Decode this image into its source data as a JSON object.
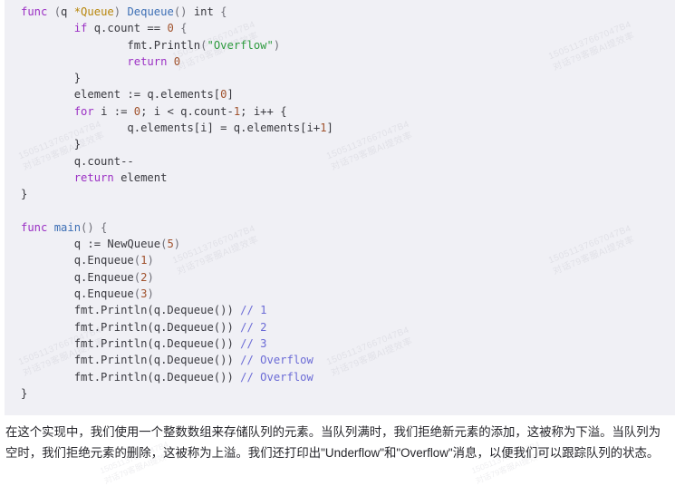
{
  "code_block": {
    "language": "go",
    "background_color": "#f0f0f5",
    "watermark_line1": "15051137667047B4",
    "watermark_line2": "对话79客服AI提效率",
    "lines": [
      {
        "indent": 0,
        "tokens": [
          {
            "t": "func ",
            "c": "kw"
          },
          {
            "t": "(",
            "c": "pun"
          },
          {
            "t": "q ",
            "c": "pl"
          },
          {
            "t": "*Queue",
            "c": "typ"
          },
          {
            "t": ") ",
            "c": "pun"
          },
          {
            "t": "Dequeue",
            "c": "fn"
          },
          {
            "t": "() ",
            "c": "pun"
          },
          {
            "t": "int",
            "c": "pl"
          },
          {
            "t": " {",
            "c": "pun"
          }
        ]
      },
      {
        "indent": 1,
        "tokens": [
          {
            "t": "if ",
            "c": "kw"
          },
          {
            "t": "q.count == ",
            "c": "pl"
          },
          {
            "t": "0",
            "c": "num"
          },
          {
            "t": " {",
            "c": "pun"
          }
        ]
      },
      {
        "indent": 2,
        "tokens": [
          {
            "t": "fmt.",
            "c": "pl"
          },
          {
            "t": "Println",
            "c": "pl"
          },
          {
            "t": "(",
            "c": "pun"
          },
          {
            "t": "\"Overflow\"",
            "c": "str"
          },
          {
            "t": ")",
            "c": "pun"
          }
        ]
      },
      {
        "indent": 2,
        "tokens": [
          {
            "t": "return ",
            "c": "kw"
          },
          {
            "t": "0",
            "c": "num"
          }
        ]
      },
      {
        "indent": 1,
        "tokens": [
          {
            "t": "}",
            "c": "pl"
          }
        ]
      },
      {
        "indent": 1,
        "tokens": [
          {
            "t": "element := q.elements[",
            "c": "pl"
          },
          {
            "t": "0",
            "c": "num"
          },
          {
            "t": "]",
            "c": "pl"
          }
        ]
      },
      {
        "indent": 1,
        "tokens": [
          {
            "t": "for ",
            "c": "kw"
          },
          {
            "t": "i := ",
            "c": "pl"
          },
          {
            "t": "0",
            "c": "num"
          },
          {
            "t": "; i < q.count-",
            "c": "pl"
          },
          {
            "t": "1",
            "c": "num"
          },
          {
            "t": "; i++ {",
            "c": "pl"
          }
        ]
      },
      {
        "indent": 2,
        "tokens": [
          {
            "t": "q.elements[i] = q.elements[i+",
            "c": "pl"
          },
          {
            "t": "1",
            "c": "num"
          },
          {
            "t": "]",
            "c": "pl"
          }
        ]
      },
      {
        "indent": 1,
        "tokens": [
          {
            "t": "}",
            "c": "pl"
          }
        ]
      },
      {
        "indent": 1,
        "tokens": [
          {
            "t": "q.count--",
            "c": "pl"
          }
        ]
      },
      {
        "indent": 1,
        "tokens": [
          {
            "t": "return ",
            "c": "kw"
          },
          {
            "t": "element",
            "c": "pl"
          }
        ]
      },
      {
        "indent": 0,
        "tokens": [
          {
            "t": "}",
            "c": "pl"
          }
        ]
      },
      {
        "indent": 0,
        "tokens": [
          {
            "t": "",
            "c": "pl"
          }
        ]
      },
      {
        "indent": 0,
        "tokens": [
          {
            "t": "func ",
            "c": "kw"
          },
          {
            "t": "main",
            "c": "fn"
          },
          {
            "t": "() {",
            "c": "pun"
          }
        ]
      },
      {
        "indent": 1,
        "tokens": [
          {
            "t": "q := ",
            "c": "pl"
          },
          {
            "t": "NewQueue",
            "c": "pl"
          },
          {
            "t": "(",
            "c": "pun"
          },
          {
            "t": "5",
            "c": "num"
          },
          {
            "t": ")",
            "c": "pun"
          }
        ]
      },
      {
        "indent": 1,
        "tokens": [
          {
            "t": "q.Enqueue",
            "c": "pl"
          },
          {
            "t": "(",
            "c": "pun"
          },
          {
            "t": "1",
            "c": "num"
          },
          {
            "t": ")",
            "c": "pun"
          }
        ]
      },
      {
        "indent": 1,
        "tokens": [
          {
            "t": "q.Enqueue",
            "c": "pl"
          },
          {
            "t": "(",
            "c": "pun"
          },
          {
            "t": "2",
            "c": "num"
          },
          {
            "t": ")",
            "c": "pun"
          }
        ]
      },
      {
        "indent": 1,
        "tokens": [
          {
            "t": "q.Enqueue",
            "c": "pl"
          },
          {
            "t": "(",
            "c": "pun"
          },
          {
            "t": "3",
            "c": "num"
          },
          {
            "t": ")",
            "c": "pun"
          }
        ]
      },
      {
        "indent": 1,
        "tokens": [
          {
            "t": "fmt.Println(q.Dequeue()) ",
            "c": "pl"
          },
          {
            "t": "// 1",
            "c": "cmt"
          }
        ]
      },
      {
        "indent": 1,
        "tokens": [
          {
            "t": "fmt.Println(q.Dequeue()) ",
            "c": "pl"
          },
          {
            "t": "// 2",
            "c": "cmt"
          }
        ]
      },
      {
        "indent": 1,
        "tokens": [
          {
            "t": "fmt.Println(q.Dequeue()) ",
            "c": "pl"
          },
          {
            "t": "// 3",
            "c": "cmt"
          }
        ]
      },
      {
        "indent": 1,
        "tokens": [
          {
            "t": "fmt.Println(q.Dequeue()) ",
            "c": "pl"
          },
          {
            "t": "// Overflow",
            "c": "cmt"
          }
        ]
      },
      {
        "indent": 1,
        "tokens": [
          {
            "t": "fmt.Println(q.Dequeue()) ",
            "c": "pl"
          },
          {
            "t": "// Overflow",
            "c": "cmt"
          }
        ]
      },
      {
        "indent": 0,
        "tokens": [
          {
            "t": "}",
            "c": "pl"
          }
        ]
      }
    ],
    "plain_text": "func (q *Queue) Dequeue() int {\n        if q.count == 0 {\n                fmt.Println(\"Overflow\")\n                return 0\n        }\n        element := q.elements[0]\n        for i := 0; i < q.count-1; i++ {\n                q.elements[i] = q.elements[i+1]\n        }\n        q.count--\n        return element\n}\n\nfunc main() {\n        q := NewQueue(5)\n        q.Enqueue(1)\n        q.Enqueue(2)\n        q.Enqueue(3)\n        fmt.Println(q.Dequeue()) // 1\n        fmt.Println(q.Dequeue()) // 2\n        fmt.Println(q.Dequeue()) // 3\n        fmt.Println(q.Dequeue()) // Overflow\n        fmt.Println(q.Dequeue()) // Overflow\n}"
  },
  "paragraph": {
    "text": "在这个实现中，我们使用一个整数数组来存储队列的元素。当队列满时，我们拒绝新元素的添加，这被称为下溢。当队列为空时，我们拒绝元素的删除，这被称为上溢。我们还打印出\"Underflow\"和\"Overflow\"消息，以便我们可以跟踪队列的状态。"
  }
}
